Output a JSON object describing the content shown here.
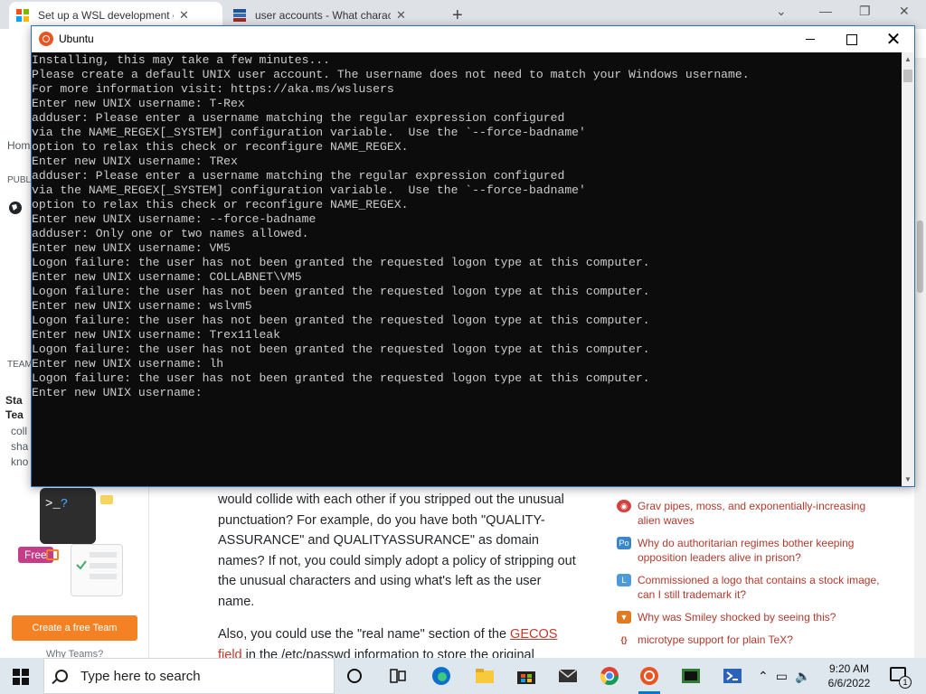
{
  "browser": {
    "tabs": [
      {
        "title": "Set up a WSL development envir",
        "active": true,
        "icon": "microsoft-icon"
      },
      {
        "title": "user accounts - What characters",
        "active": false,
        "icon": "stackexchange-icon"
      }
    ]
  },
  "webpage": {
    "sidebar": {
      "home_fragment": "Hom",
      "public_fragment": "PUBL",
      "teams_fragment": "TEAM",
      "teams_title_1": "Sta",
      "teams_title_2": "Tea",
      "teams_desc": [
        "coll",
        "sha",
        "kno"
      ],
      "free_badge": "Free",
      "create_team_button": "Create a free Team",
      "why_teams": "Why Teams?"
    },
    "answer": {
      "paragraph1": "would collide with each other if you stripped out the unusual punctuation? For example, do you have both \"QUALITY-ASSURANCE\" and QUALITYASSURANCE\" as domain names? If not, you could simply adopt a policy of stripping out the unusual characters and using what's left as the user name.",
      "paragraph2_start": "Also, you could use the \"real name\" section of the ",
      "paragraph2_link": "GECOS field",
      "paragraph2_end": " in the /etc/passwd information to store the original"
    },
    "hot_questions": [
      {
        "icon": "worldbuilding-icon",
        "color": "#d3413f",
        "text": "Grav pipes, moss, and exponentially-increasing alien waves"
      },
      {
        "icon": "politics-icon",
        "color": "#3a86c8",
        "text": "Why do authoritarian regimes bother keeping opposition leaders alive in prison?"
      },
      {
        "icon": "law-icon",
        "color": "#4d9ad8",
        "text": "Commissioned a logo that contains a stock image, can I still trademark it?"
      },
      {
        "icon": "movies-icon",
        "color": "#e07b22",
        "text": "Why was Smiley shocked by seeing this?"
      },
      {
        "icon": "tex-icon",
        "color": "#c0392b",
        "text": "microtype support for plain TeX?"
      }
    ]
  },
  "terminal": {
    "title": "Ubuntu",
    "lines": [
      "Installing, this may take a few minutes...",
      "Please create a default UNIX user account. The username does not need to match your Windows username.",
      "For more information visit: https://aka.ms/wslusers",
      "Enter new UNIX username: T-Rex",
      "adduser: Please enter a username matching the regular expression configured",
      "via the NAME_REGEX[_SYSTEM] configuration variable.  Use the `--force-badname'",
      "option to relax this check or reconfigure NAME_REGEX.",
      "Enter new UNIX username: TRex",
      "adduser: Please enter a username matching the regular expression configured",
      "via the NAME_REGEX[_SYSTEM] configuration variable.  Use the `--force-badname'",
      "option to relax this check or reconfigure NAME_REGEX.",
      "Enter new UNIX username: --force-badname",
      "adduser: Only one or two names allowed.",
      "Enter new UNIX username: VM5",
      "Logon failure: the user has not been granted the requested logon type at this computer.",
      "Enter new UNIX username: COLLABNET\\VM5",
      "Logon failure: the user has not been granted the requested logon type at this computer.",
      "Enter new UNIX username: wslvm5",
      "Logon failure: the user has not been granted the requested logon type at this computer.",
      "Enter new UNIX username: Trex11leak",
      "Logon failure: the user has not been granted the requested logon type at this computer.",
      "Enter new UNIX username: lh",
      "Logon failure: the user has not been granted the requested logon type at this computer.",
      "Enter new UNIX username:"
    ]
  },
  "taskbar": {
    "search_placeholder": "Type here to search",
    "time": "9:20 AM",
    "date": "6/6/2022",
    "notification_count": "1",
    "apps": [
      "task-view-icon",
      "edge-icon",
      "file-explorer-icon",
      "store-icon",
      "mail-icon",
      "chrome-icon",
      "ubuntu-icon",
      "terminal-app-icon",
      "powershell-icon"
    ]
  },
  "colors": {
    "terminal_bg": "#0c0c0c",
    "terminal_text": "#cccccc",
    "accent_orange": "#f48225",
    "link_red": "#c0392b"
  }
}
